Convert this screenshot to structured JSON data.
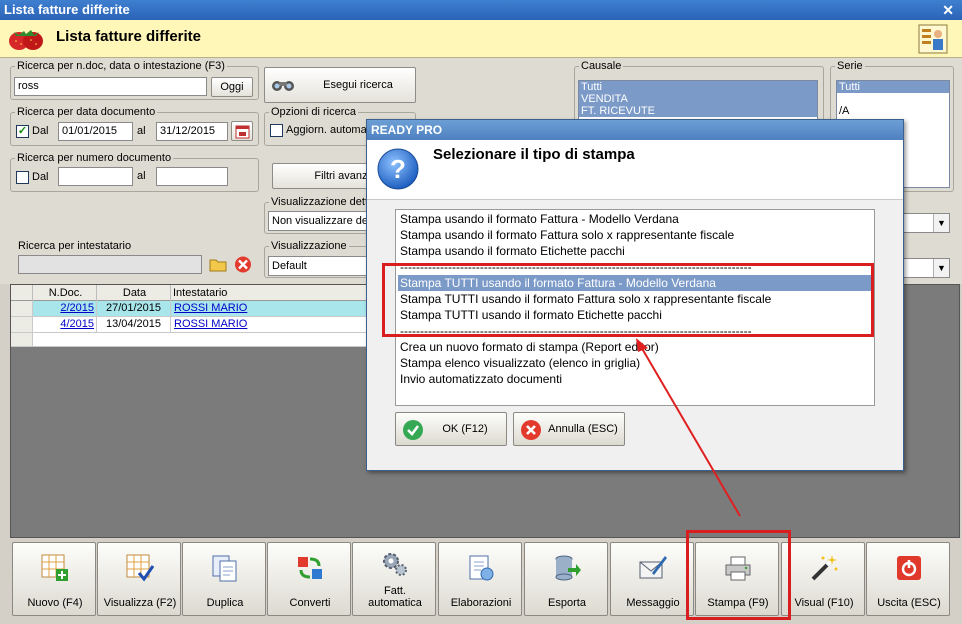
{
  "window": {
    "title": "Lista fatture differite"
  },
  "header": {
    "title": "Lista fatture differite"
  },
  "search_text": {
    "legend": "Ricerca per n.doc, data o intestazione (F3)",
    "value": "ross",
    "ok_label": "Oggi"
  },
  "search_button": {
    "label": "Esegui ricerca"
  },
  "search_date": {
    "legend": "Ricerca per data documento",
    "from_label": "Dal",
    "from_value": "01/01/2015",
    "to_label": "al",
    "to_value": "31/12/2015"
  },
  "search_options": {
    "legend": "Opzioni di ricerca",
    "auto_label": "Aggiorn. automa",
    "filters_label": "Filtri avanza"
  },
  "search_number": {
    "legend": "Ricerca per numero documento",
    "from_label": "Dal",
    "to_label": "al"
  },
  "detail_view": {
    "legend": "Visualizzazione detta",
    "value": "Non visualizzare det"
  },
  "search_holder": {
    "legend": "Ricerca per intestatario"
  },
  "view": {
    "legend": "Visualizzazione",
    "value": "Default"
  },
  "causale": {
    "legend": "Causale",
    "items": [
      "Tutti",
      "VENDITA",
      "FT. RICEVUTE"
    ]
  },
  "serie": {
    "legend": "Serie",
    "items": [
      "Tutti",
      "",
      "/A"
    ]
  },
  "grid": {
    "columns": [
      "N.Doc.",
      "Data",
      "Intestatario"
    ],
    "rows": [
      {
        "num": "2/2015",
        "date": "27/01/2015",
        "holder": "ROSSI MARIO"
      },
      {
        "num": "4/2015",
        "date": "13/04/2015",
        "holder": "ROSSI MARIO"
      }
    ]
  },
  "toolbar": {
    "new": "Nuovo (F4)",
    "view": "Visualizza (F2)",
    "duplicate": "Duplica",
    "convert": "Converti",
    "auto_invoice_1": "Fatt.",
    "auto_invoice_2": "automatica",
    "processing": "Elaborazioni",
    "export": "Esporta",
    "message": "Messaggio",
    "print": "Stampa (F9)",
    "visual": "Visual (F10)",
    "exit": "Uscita (ESC)"
  },
  "dialog": {
    "title": "READY PRO",
    "heading": "Selezionare il tipo di stampa",
    "options": [
      "Stampa usando il formato Fattura - Modello Verdana",
      "Stampa usando il formato Fattura solo x rappresentante fiscale",
      "Stampa usando il formato Etichette pacchi",
      "----------------------------------------------------------------------------------------",
      "Stampa TUTTI usando il formato Fattura - Modello Verdana",
      "Stampa TUTTI usando il formato Fattura solo x rappresentante fiscale",
      "Stampa TUTTI usando il formato Etichette pacchi",
      "----------------------------------------------------------------------------------------",
      "Crea un nuovo formato di stampa (Report editor)",
      "Stampa elenco visualizzato (elenco in griglia)",
      "Invio automatizzato documenti"
    ],
    "ok_label": "OK (F12)",
    "cancel_label": "Annulla (ESC)"
  },
  "colors": {
    "titlebar": "#2a63b7",
    "header": "#fff7b8",
    "selection": "#7c9ac7",
    "highlight": "#d81e1e",
    "grid_selected_row": "#a8e6ec"
  }
}
